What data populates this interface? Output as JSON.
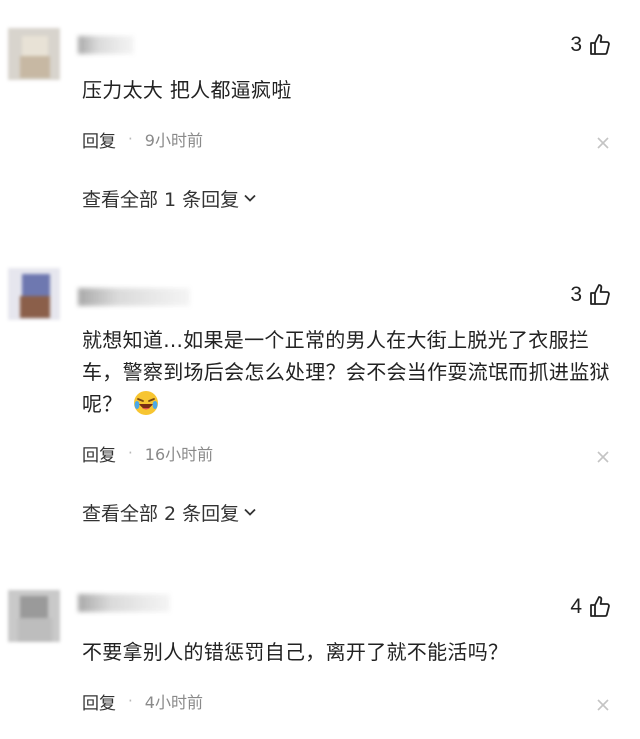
{
  "comments": [
    {
      "likes": "3",
      "text": "压力太大 把人都逼疯啦",
      "reply_label": "回复",
      "separator": "·",
      "time": "9小时前",
      "view_all": "查看全部 1 条回复"
    },
    {
      "likes": "3",
      "text": "就想知道...如果是一个正常的男人在大街上脱光了衣服拦车，警察到场后会怎么处理？会不会当作耍流氓而抓进监狱呢？",
      "emoji": "laughing-crying-emoji",
      "reply_label": "回复",
      "separator": "·",
      "time": "16小时前",
      "view_all": "查看全部 2 条回复"
    },
    {
      "likes": "4",
      "text": "不要拿别人的错惩罚自己，离开了就不能活吗？",
      "reply_label": "回复",
      "separator": "·",
      "time": "4小时前"
    }
  ],
  "icons": {
    "like": "thumbs-up-icon",
    "close": "close-icon",
    "expand": "chevron-down-icon"
  },
  "colors": {
    "text": "#222222",
    "meta": "#8a8a8a",
    "icon": "#c4c4c4"
  }
}
